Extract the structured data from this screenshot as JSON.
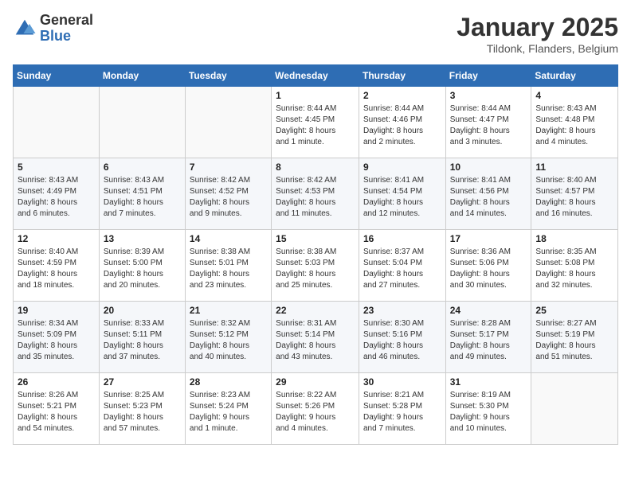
{
  "logo": {
    "general": "General",
    "blue": "Blue"
  },
  "title": "January 2025",
  "location": "Tildonk, Flanders, Belgium",
  "weekdays": [
    "Sunday",
    "Monday",
    "Tuesday",
    "Wednesday",
    "Thursday",
    "Friday",
    "Saturday"
  ],
  "weeks": [
    [
      {
        "day": "",
        "info": ""
      },
      {
        "day": "",
        "info": ""
      },
      {
        "day": "",
        "info": ""
      },
      {
        "day": "1",
        "info": "Sunrise: 8:44 AM\nSunset: 4:45 PM\nDaylight: 8 hours\nand 1 minute."
      },
      {
        "day": "2",
        "info": "Sunrise: 8:44 AM\nSunset: 4:46 PM\nDaylight: 8 hours\nand 2 minutes."
      },
      {
        "day": "3",
        "info": "Sunrise: 8:44 AM\nSunset: 4:47 PM\nDaylight: 8 hours\nand 3 minutes."
      },
      {
        "day": "4",
        "info": "Sunrise: 8:43 AM\nSunset: 4:48 PM\nDaylight: 8 hours\nand 4 minutes."
      }
    ],
    [
      {
        "day": "5",
        "info": "Sunrise: 8:43 AM\nSunset: 4:49 PM\nDaylight: 8 hours\nand 6 minutes."
      },
      {
        "day": "6",
        "info": "Sunrise: 8:43 AM\nSunset: 4:51 PM\nDaylight: 8 hours\nand 7 minutes."
      },
      {
        "day": "7",
        "info": "Sunrise: 8:42 AM\nSunset: 4:52 PM\nDaylight: 8 hours\nand 9 minutes."
      },
      {
        "day": "8",
        "info": "Sunrise: 8:42 AM\nSunset: 4:53 PM\nDaylight: 8 hours\nand 11 minutes."
      },
      {
        "day": "9",
        "info": "Sunrise: 8:41 AM\nSunset: 4:54 PM\nDaylight: 8 hours\nand 12 minutes."
      },
      {
        "day": "10",
        "info": "Sunrise: 8:41 AM\nSunset: 4:56 PM\nDaylight: 8 hours\nand 14 minutes."
      },
      {
        "day": "11",
        "info": "Sunrise: 8:40 AM\nSunset: 4:57 PM\nDaylight: 8 hours\nand 16 minutes."
      }
    ],
    [
      {
        "day": "12",
        "info": "Sunrise: 8:40 AM\nSunset: 4:59 PM\nDaylight: 8 hours\nand 18 minutes."
      },
      {
        "day": "13",
        "info": "Sunrise: 8:39 AM\nSunset: 5:00 PM\nDaylight: 8 hours\nand 20 minutes."
      },
      {
        "day": "14",
        "info": "Sunrise: 8:38 AM\nSunset: 5:01 PM\nDaylight: 8 hours\nand 23 minutes."
      },
      {
        "day": "15",
        "info": "Sunrise: 8:38 AM\nSunset: 5:03 PM\nDaylight: 8 hours\nand 25 minutes."
      },
      {
        "day": "16",
        "info": "Sunrise: 8:37 AM\nSunset: 5:04 PM\nDaylight: 8 hours\nand 27 minutes."
      },
      {
        "day": "17",
        "info": "Sunrise: 8:36 AM\nSunset: 5:06 PM\nDaylight: 8 hours\nand 30 minutes."
      },
      {
        "day": "18",
        "info": "Sunrise: 8:35 AM\nSunset: 5:08 PM\nDaylight: 8 hours\nand 32 minutes."
      }
    ],
    [
      {
        "day": "19",
        "info": "Sunrise: 8:34 AM\nSunset: 5:09 PM\nDaylight: 8 hours\nand 35 minutes."
      },
      {
        "day": "20",
        "info": "Sunrise: 8:33 AM\nSunset: 5:11 PM\nDaylight: 8 hours\nand 37 minutes."
      },
      {
        "day": "21",
        "info": "Sunrise: 8:32 AM\nSunset: 5:12 PM\nDaylight: 8 hours\nand 40 minutes."
      },
      {
        "day": "22",
        "info": "Sunrise: 8:31 AM\nSunset: 5:14 PM\nDaylight: 8 hours\nand 43 minutes."
      },
      {
        "day": "23",
        "info": "Sunrise: 8:30 AM\nSunset: 5:16 PM\nDaylight: 8 hours\nand 46 minutes."
      },
      {
        "day": "24",
        "info": "Sunrise: 8:28 AM\nSunset: 5:17 PM\nDaylight: 8 hours\nand 49 minutes."
      },
      {
        "day": "25",
        "info": "Sunrise: 8:27 AM\nSunset: 5:19 PM\nDaylight: 8 hours\nand 51 minutes."
      }
    ],
    [
      {
        "day": "26",
        "info": "Sunrise: 8:26 AM\nSunset: 5:21 PM\nDaylight: 8 hours\nand 54 minutes."
      },
      {
        "day": "27",
        "info": "Sunrise: 8:25 AM\nSunset: 5:23 PM\nDaylight: 8 hours\nand 57 minutes."
      },
      {
        "day": "28",
        "info": "Sunrise: 8:23 AM\nSunset: 5:24 PM\nDaylight: 9 hours\nand 1 minute."
      },
      {
        "day": "29",
        "info": "Sunrise: 8:22 AM\nSunset: 5:26 PM\nDaylight: 9 hours\nand 4 minutes."
      },
      {
        "day": "30",
        "info": "Sunrise: 8:21 AM\nSunset: 5:28 PM\nDaylight: 9 hours\nand 7 minutes."
      },
      {
        "day": "31",
        "info": "Sunrise: 8:19 AM\nSunset: 5:30 PM\nDaylight: 9 hours\nand 10 minutes."
      },
      {
        "day": "",
        "info": ""
      }
    ]
  ]
}
